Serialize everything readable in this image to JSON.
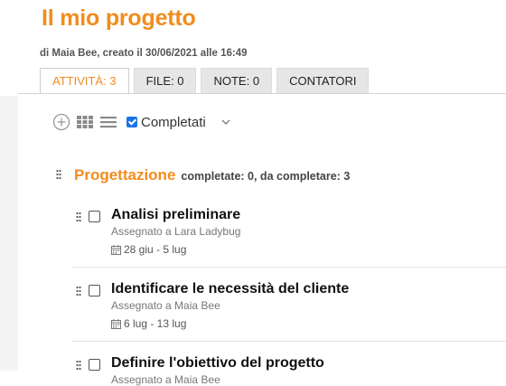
{
  "project": {
    "title": "Il mio progetto",
    "subtitle": "di Maia Bee, creato il 30/06/2021 alle 16:49"
  },
  "tabs": [
    {
      "label": "ATTIVITÀ: 3",
      "active": true
    },
    {
      "label": "FILE: 0",
      "active": false
    },
    {
      "label": "NOTE: 0",
      "active": false
    },
    {
      "label": "CONTATORI",
      "active": false
    }
  ],
  "toolbar": {
    "add_icon": "plus-circle-icon",
    "grid_icon": "grid-icon",
    "list_icon": "list-icon",
    "completed_checked": true,
    "completed_label": "Completati",
    "dropdown_icon": "chevron-down-icon"
  },
  "section": {
    "title": "Progettazione",
    "stats": "completate: 0, da completare: 3"
  },
  "tasks": [
    {
      "title": "Analisi preliminare",
      "assigned": "Assegnato a Lara Ladybug",
      "dates": "28 giu - 5 lug",
      "checked": false
    },
    {
      "title": "Identificare le necessità del cliente",
      "assigned": "Assegnato a Maia Bee",
      "dates": "6 lug - 13 lug",
      "checked": false
    },
    {
      "title": "Definire l'obiettivo del progetto",
      "assigned": "Assegnato a Maia Bee",
      "dates": "",
      "checked": false
    }
  ],
  "colors": {
    "accent": "#f28c1c",
    "checkbox_blue": "#1a73e8"
  }
}
